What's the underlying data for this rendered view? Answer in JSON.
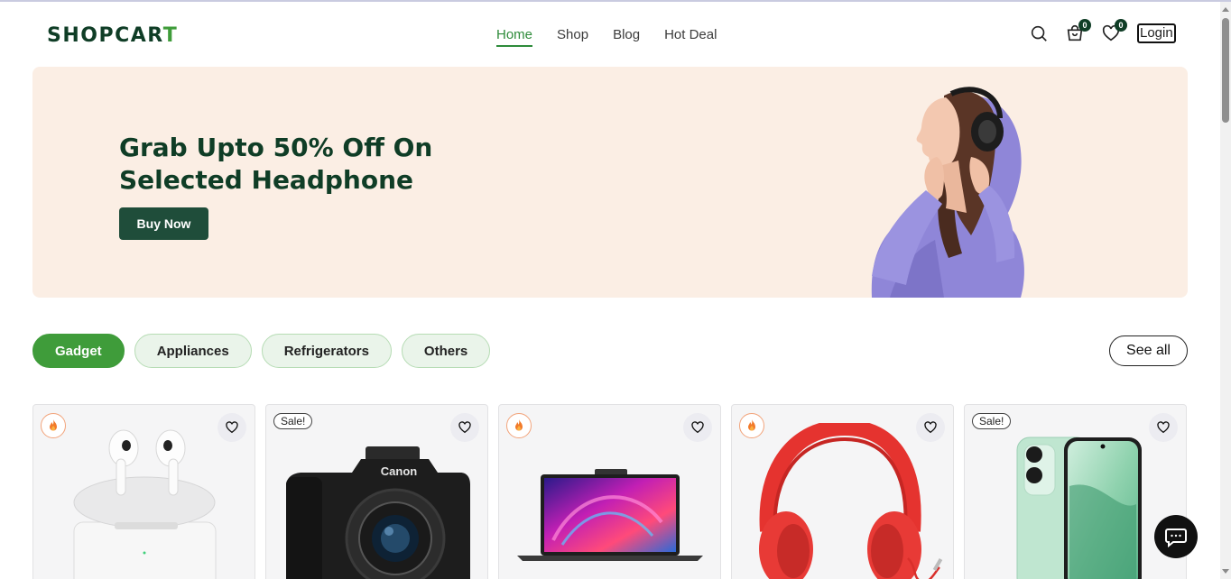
{
  "header": {
    "logo_main": "SHOPCAR",
    "logo_accent": "T",
    "nav": [
      "Home",
      "Shop",
      "Blog",
      "Hot Deal"
    ],
    "cart_count": "0",
    "wishlist_count": "0",
    "login_label": "Login"
  },
  "banner": {
    "title_line1": "Grab Upto 50% Off On",
    "title_line2": "Selected Headphone",
    "button_label": "Buy Now"
  },
  "categories": {
    "tabs": [
      "Gadget",
      "Appliances",
      "Refrigerators",
      "Others"
    ],
    "active_tab": "Gadget",
    "see_all_label": "See all"
  },
  "products": [
    {
      "badge": "fire",
      "image": "airpods"
    },
    {
      "badge": "Sale!",
      "image": "canon-camera",
      "brand_text": "Canon"
    },
    {
      "badge": "fire",
      "image": "laptop"
    },
    {
      "badge": "fire",
      "image": "red-headphones"
    },
    {
      "badge": "Sale!",
      "image": "green-phone"
    }
  ],
  "colors": {
    "brand_dark": "#0f3d26",
    "brand_green": "#3f9c3a",
    "banner_bg": "#fbeee4",
    "tab_bg": "#eaf4ea",
    "card_bg": "#f5f5f6"
  },
  "icons": [
    "search-icon",
    "cart-icon",
    "heart-icon",
    "fire-icon",
    "chat-icon"
  ]
}
